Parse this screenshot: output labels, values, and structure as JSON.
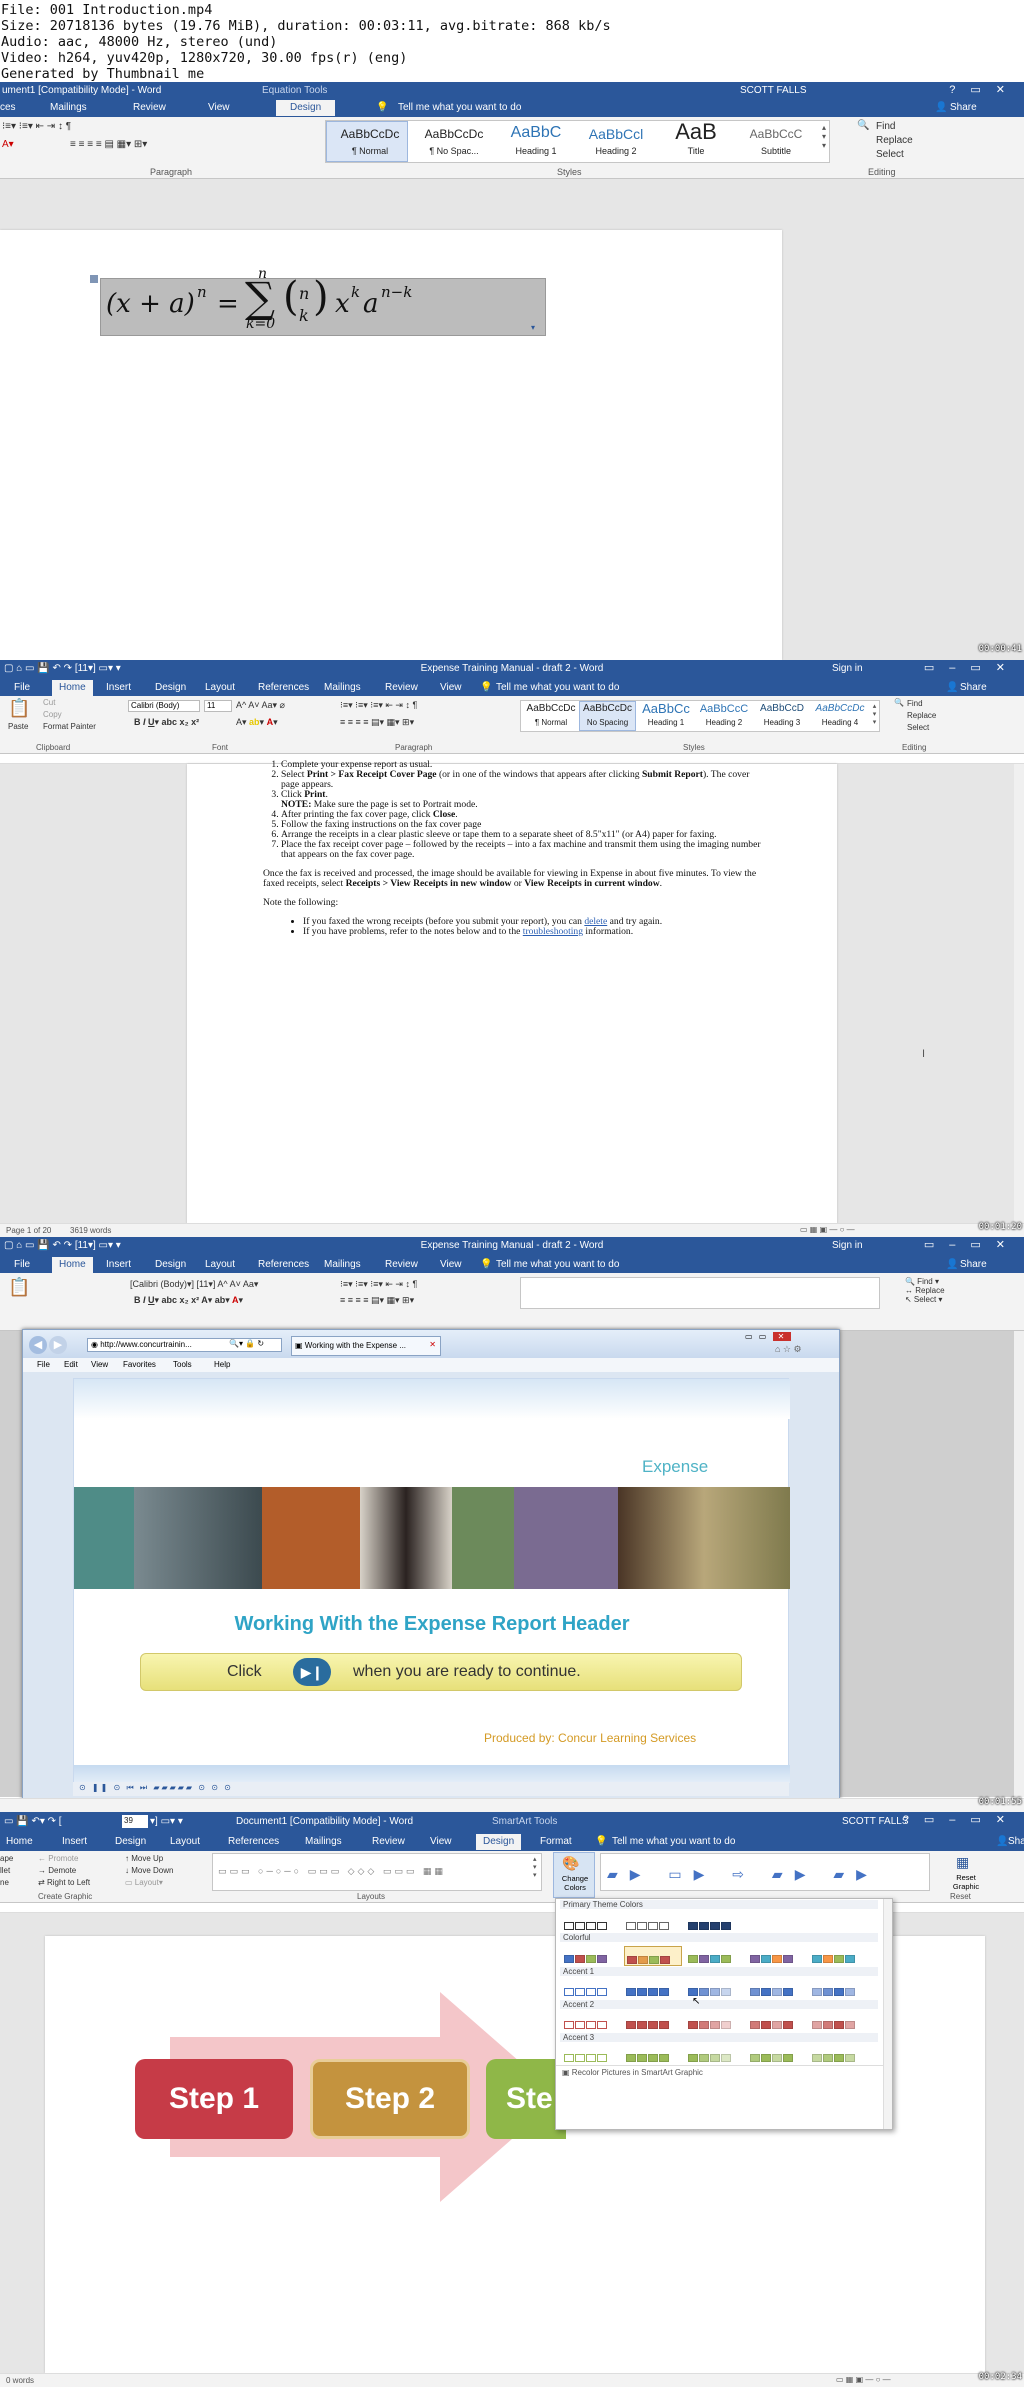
{
  "file_info": [
    "File: 001 Introduction.mp4",
    "Size: 20718136 bytes (19.76 MiB), duration: 00:03:11, avg.bitrate: 868 kb/s",
    "Audio: aac, 48000 Hz, stereo (und)",
    "Video: h264, yuv420p, 1280x720, 30.00 fps(r) (eng)",
    "Generated by Thumbnail me"
  ],
  "frame1": {
    "title": "ument1 [Compatibility Mode] - Word",
    "context_tab": "Equation Tools",
    "user": "SCOTT FALLS",
    "tabs": [
      "ces",
      "Mailings",
      "Review",
      "View",
      "Design"
    ],
    "tell_me": "Tell me what you want to do",
    "share": "Share",
    "styles": [
      {
        "preview": "AaBbCcDc",
        "name": "¶ Normal"
      },
      {
        "preview": "AaBbCcDc",
        "name": "¶ No Spac..."
      },
      {
        "preview": "AaBbC",
        "name": "Heading 1"
      },
      {
        "preview": "AaBbCcl",
        "name": "Heading 2"
      },
      {
        "preview": "AaB",
        "name": "Title"
      },
      {
        "preview": "AaBbCcC",
        "name": "Subtitle"
      }
    ],
    "editing": [
      "Find",
      "Replace",
      "Select"
    ],
    "group_labels": {
      "paragraph": "Paragraph",
      "styles": "Styles",
      "editing": "Editing"
    },
    "equation": {
      "lhs": "(x + a)",
      "lhs_exp": "n",
      "eq": "=",
      "sum_top": "n",
      "sum_bottom": "k=0",
      "binom_top": "n",
      "binom_bottom": "k",
      "x": "x",
      "k": "k",
      "a": "a",
      "exp2": "n−k"
    },
    "timestamp": "00:00:41"
  },
  "frame2": {
    "title": "Expense Training Manual - draft 2 - Word",
    "sign_in": "Sign in",
    "tabs": [
      "File",
      "Home",
      "Insert",
      "Design",
      "Layout",
      "References",
      "Mailings",
      "Review",
      "View"
    ],
    "tell_me": "Tell me what you want to do",
    "share": "Share",
    "clipboard": {
      "paste": "Paste",
      "cut": "Cut",
      "copy": "Copy",
      "format_painter": "Format Painter"
    },
    "font": "Calibri (Body)",
    "size": "11",
    "styles": [
      {
        "preview": "AaBbCcDc",
        "name": "¶ Normal"
      },
      {
        "preview": "AaBbCcDc",
        "name": "No Spacing"
      },
      {
        "preview": "AaBbCc",
        "name": "Heading 1"
      },
      {
        "preview": "AaBbCcC",
        "name": "Heading 2"
      },
      {
        "preview": "AaBbCcD",
        "name": "Heading 3"
      },
      {
        "preview": "AaBbCcDc",
        "name": "Heading 4"
      }
    ],
    "editing": [
      "Find",
      "Replace",
      "Select"
    ],
    "group_labels": {
      "clipboard": "Clipboard",
      "font": "Font",
      "paragraph": "Paragraph",
      "styles": "Styles",
      "editing": "Editing"
    },
    "doc": {
      "li1": "Complete your expense report as usual.",
      "li2a": "Select ",
      "li2b": "Print > Fax Receipt Cover Page",
      "li2c": " (or in one of the windows that appears after clicking ",
      "li2d": "Submit Report",
      "li2e": "). The cover page appears.",
      "li3a": "Click ",
      "li3b": "Print",
      "li3c": ".",
      "note_a": "NOTE:",
      "note_b": " Make sure the page is set to Portrait mode.",
      "li4a": "After printing the fax cover page, click ",
      "li4b": "Close",
      "li4c": ".",
      "li5": "Follow the faxing instructions on the fax cover page",
      "li6": "Arrange the receipts in a clear plastic sleeve or tape them to a separate sheet of 8.5\"x11\" (or A4) paper for faxing.",
      "li7": "Place the fax receipt cover page – followed by the receipts – into a fax machine and transmit them using the imaging number that appears on the fax cover page.",
      "para_a": "Once the fax is received and processed, the image should be available for viewing in Expense in about five minutes. To view the faxed receipts, select ",
      "para_b": "Receipts > View Receipts in new window",
      "para_c": " or ",
      "para_d": "View Receipts in current window",
      "para_e": ".",
      "note_head": "Note the following:",
      "b1a": "If you faxed the wrong receipts (before you submit your report), you can ",
      "b1b": "delete",
      "b1c": " and try again.",
      "b2a": "If you have problems, refer to the notes below and to the ",
      "b2b": "troubleshooting",
      "b2c": " information."
    },
    "status": {
      "page": "Page 1 of 20",
      "words": "3619 words"
    },
    "timestamp": "00:01:20"
  },
  "frame3": {
    "title": "Expense Training Manual - draft 2 - Word",
    "sign_in": "Sign in",
    "tabs": [
      "File",
      "Home",
      "Insert",
      "Design",
      "Layout",
      "References",
      "Mailings",
      "Review",
      "View"
    ],
    "tell_me": "Tell me what you want to do",
    "share": "Share",
    "browser": {
      "url": "http://www.concurtrainin...",
      "tab": "Working with the Expense ...",
      "menu": [
        "File",
        "Edit",
        "View",
        "Favorites",
        "Tools",
        "Help"
      ]
    },
    "slide": {
      "brand": "Expense",
      "heading": "Working With the Expense Report Header",
      "click_a": "Click",
      "click_b": "when you are ready to continue.",
      "produced": "Produced by: Concur Learning Services"
    },
    "timestamp": "00:01:55"
  },
  "frame4": {
    "title": "Document1 [Compatibility Mode] - Word",
    "context_tab": "SmartArt Tools",
    "user": "SCOTT FALLS",
    "zoom_box": "39",
    "tabs": [
      "Home",
      "Insert",
      "Design",
      "Layout",
      "References",
      "Mailings",
      "Review",
      "View",
      "Design",
      "Format"
    ],
    "tell_me": "Tell me what you want to do",
    "share": "Sha",
    "create_graphic": {
      "promote": "Promote",
      "demote": "Demote",
      "rtl": "Right to Left",
      "up": "Move Up",
      "down": "Move Down",
      "layout": "Layout",
      "left1": "ape",
      "left2": "llet",
      "left3": "ne"
    },
    "change_colors": "Change Colors",
    "reset_graphic": "Reset Graphic",
    "group_labels": {
      "create": "Create Graphic",
      "layouts": "Layouts",
      "reset": "Reset"
    },
    "palette": {
      "primary": "Primary Theme Colors",
      "colorful": "Colorful",
      "accent1": "Accent 1",
      "accent2": "Accent 2",
      "accent3": "Accent 3",
      "recolor": "Recolor Pictures in SmartArt Graphic"
    },
    "steps": [
      "Step 1",
      "Step 2",
      "Ste"
    ],
    "status": {
      "words": "0 words"
    },
    "timestamp": "00:02:34"
  }
}
